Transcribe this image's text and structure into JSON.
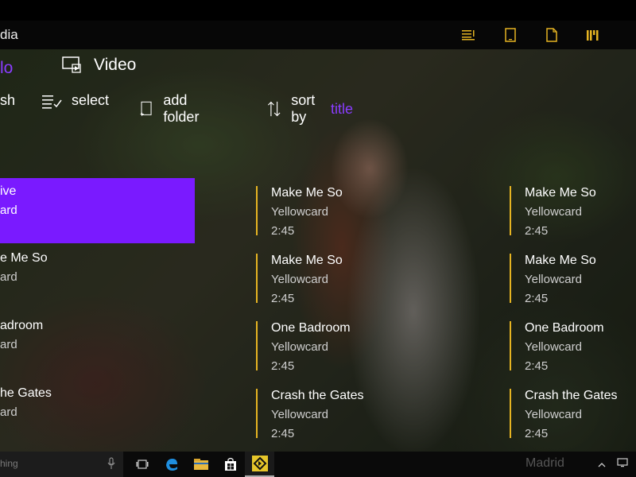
{
  "app": {
    "title_visible": "dia"
  },
  "toolbar_icons": [
    "playlist-icon",
    "tablet-icon",
    "file-icon",
    "library-icon"
  ],
  "tabs": {
    "audio": "lo",
    "video": "Video"
  },
  "commands": {
    "refresh": "sh",
    "select": "select",
    "add_folder": "add folder",
    "sort_by": "sort by",
    "sort_value": "title"
  },
  "songs": {
    "col1": [
      {
        "title": "ive",
        "artist": "ard",
        "duration": "",
        "selected": true
      },
      {
        "title": "e Me So",
        "artist": "ard",
        "duration": ""
      },
      {
        "title": "adroom",
        "artist": "ard",
        "duration": ""
      },
      {
        "title": "he Gates",
        "artist": "ard",
        "duration": ""
      }
    ],
    "col2": [
      {
        "title": "Make Me So",
        "artist": "Yellowcard",
        "duration": "2:45"
      },
      {
        "title": "Make Me So",
        "artist": "Yellowcard",
        "duration": "2:45"
      },
      {
        "title": "One Badroom",
        "artist": "Yellowcard",
        "duration": "2:45"
      },
      {
        "title": "Crash the Gates",
        "artist": "Yellowcard",
        "duration": "2:45"
      }
    ],
    "col3": [
      {
        "title": "Make Me So",
        "artist": "Yellowcard",
        "duration": "2:45"
      },
      {
        "title": "Make Me So",
        "artist": "Yellowcard",
        "duration": "2:45"
      },
      {
        "title": "One Badroom",
        "artist": "Yellowcard",
        "duration": "2:45"
      },
      {
        "title": "Crash the Gates",
        "artist": "Yellowcard",
        "duration": "2:45"
      }
    ],
    "ghost_next": "Madrid"
  },
  "taskbar": {
    "search_placeholder": "hing",
    "icons": [
      "task-view-icon",
      "edge-icon",
      "file-explorer-icon",
      "store-icon",
      "app-icon"
    ]
  },
  "colors": {
    "accent": "#7a1aff",
    "bar": "#e6b422"
  }
}
